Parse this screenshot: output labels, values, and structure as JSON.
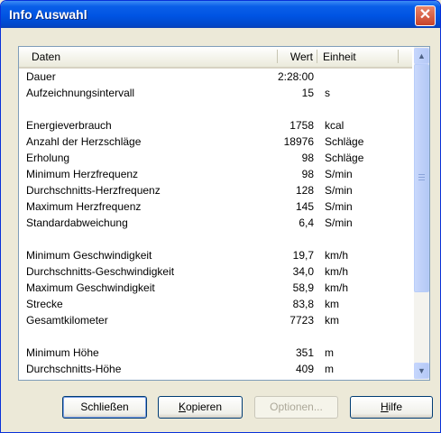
{
  "window": {
    "title": "Info Auswahl",
    "close_icon": "close-icon"
  },
  "columns": {
    "label": "Daten",
    "value": "Wert",
    "unit": "Einheit"
  },
  "rows": [
    {
      "label": "Dauer",
      "value": "2:28:00",
      "unit": ""
    },
    {
      "label": "Aufzeichnungsintervall",
      "value": "15",
      "unit": "s"
    },
    {
      "label": "",
      "value": "",
      "unit": ""
    },
    {
      "label": "Energieverbrauch",
      "value": "1758",
      "unit": "kcal"
    },
    {
      "label": "Anzahl der Herzschläge",
      "value": "18976",
      "unit": "Schläge"
    },
    {
      "label": "Erholung",
      "value": "98",
      "unit": "Schläge"
    },
    {
      "label": "Minimum Herzfrequenz",
      "value": "98",
      "unit": "S/min"
    },
    {
      "label": "Durchschnitts-Herzfrequenz",
      "value": "128",
      "unit": "S/min"
    },
    {
      "label": "Maximum Herzfrequenz",
      "value": "145",
      "unit": "S/min"
    },
    {
      "label": "Standardabweichung",
      "value": "6,4",
      "unit": "S/min"
    },
    {
      "label": "",
      "value": "",
      "unit": ""
    },
    {
      "label": "Minimum Geschwindigkeit",
      "value": "19,7",
      "unit": "km/h"
    },
    {
      "label": "Durchschnitts-Geschwindigkeit",
      "value": "34,0",
      "unit": "km/h"
    },
    {
      "label": "Maximum Geschwindigkeit",
      "value": "58,9",
      "unit": "km/h"
    },
    {
      "label": "Strecke",
      "value": "83,8",
      "unit": "km"
    },
    {
      "label": "Gesamtkilometer",
      "value": "7723",
      "unit": "km"
    },
    {
      "label": "",
      "value": "",
      "unit": ""
    },
    {
      "label": "Minimum Höhe",
      "value": "351",
      "unit": "m"
    },
    {
      "label": "Durchschnitts-Höhe",
      "value": "409",
      "unit": "m"
    }
  ],
  "buttons": {
    "close": {
      "first": "Schließen",
      "rest": ""
    },
    "copy": {
      "first": "K",
      "rest": "opieren"
    },
    "options": "Optionen...",
    "help": {
      "first": "H",
      "rest": "ilfe"
    }
  },
  "scrollbar": {
    "up_icon": "scroll-up-icon",
    "down_icon": "scroll-down-icon"
  }
}
